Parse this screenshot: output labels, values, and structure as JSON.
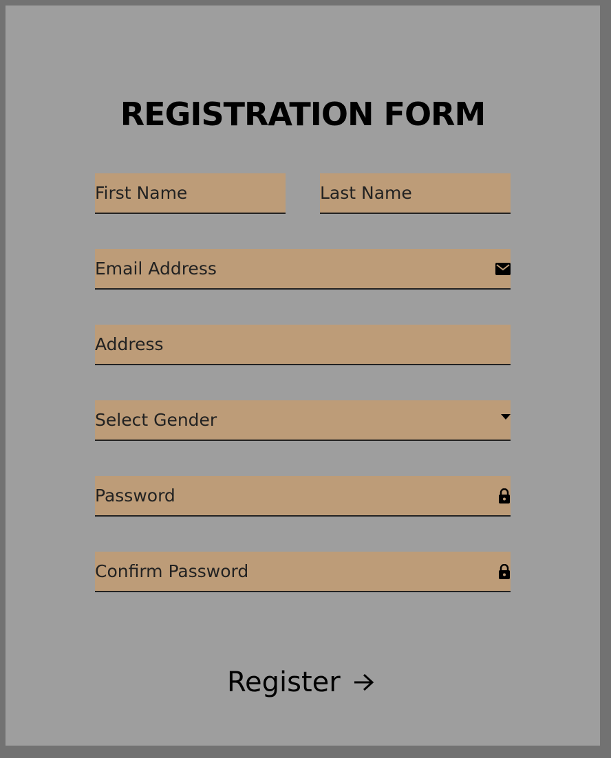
{
  "form": {
    "title": "REGISTRATION FORM",
    "fields": {
      "first_name": {
        "placeholder": "First Name",
        "value": ""
      },
      "last_name": {
        "placeholder": "Last Name",
        "value": ""
      },
      "email": {
        "placeholder": "Email Address",
        "value": "",
        "icon": "envelope-icon"
      },
      "address": {
        "placeholder": "Address",
        "value": ""
      },
      "gender": {
        "selected": "Select Gender",
        "icon": "caret-down-icon"
      },
      "password": {
        "placeholder": "Password",
        "value": "",
        "icon": "lock-icon"
      },
      "confirm_password": {
        "placeholder": "Confirm Password",
        "value": "",
        "icon": "lock-icon"
      }
    },
    "submit": {
      "label": "Register",
      "icon": "arrow-right-icon"
    }
  },
  "colors": {
    "page_background": "#727272",
    "panel_background": "#9e9e9e",
    "field_background": "#bd9c78",
    "text": "#000000"
  }
}
